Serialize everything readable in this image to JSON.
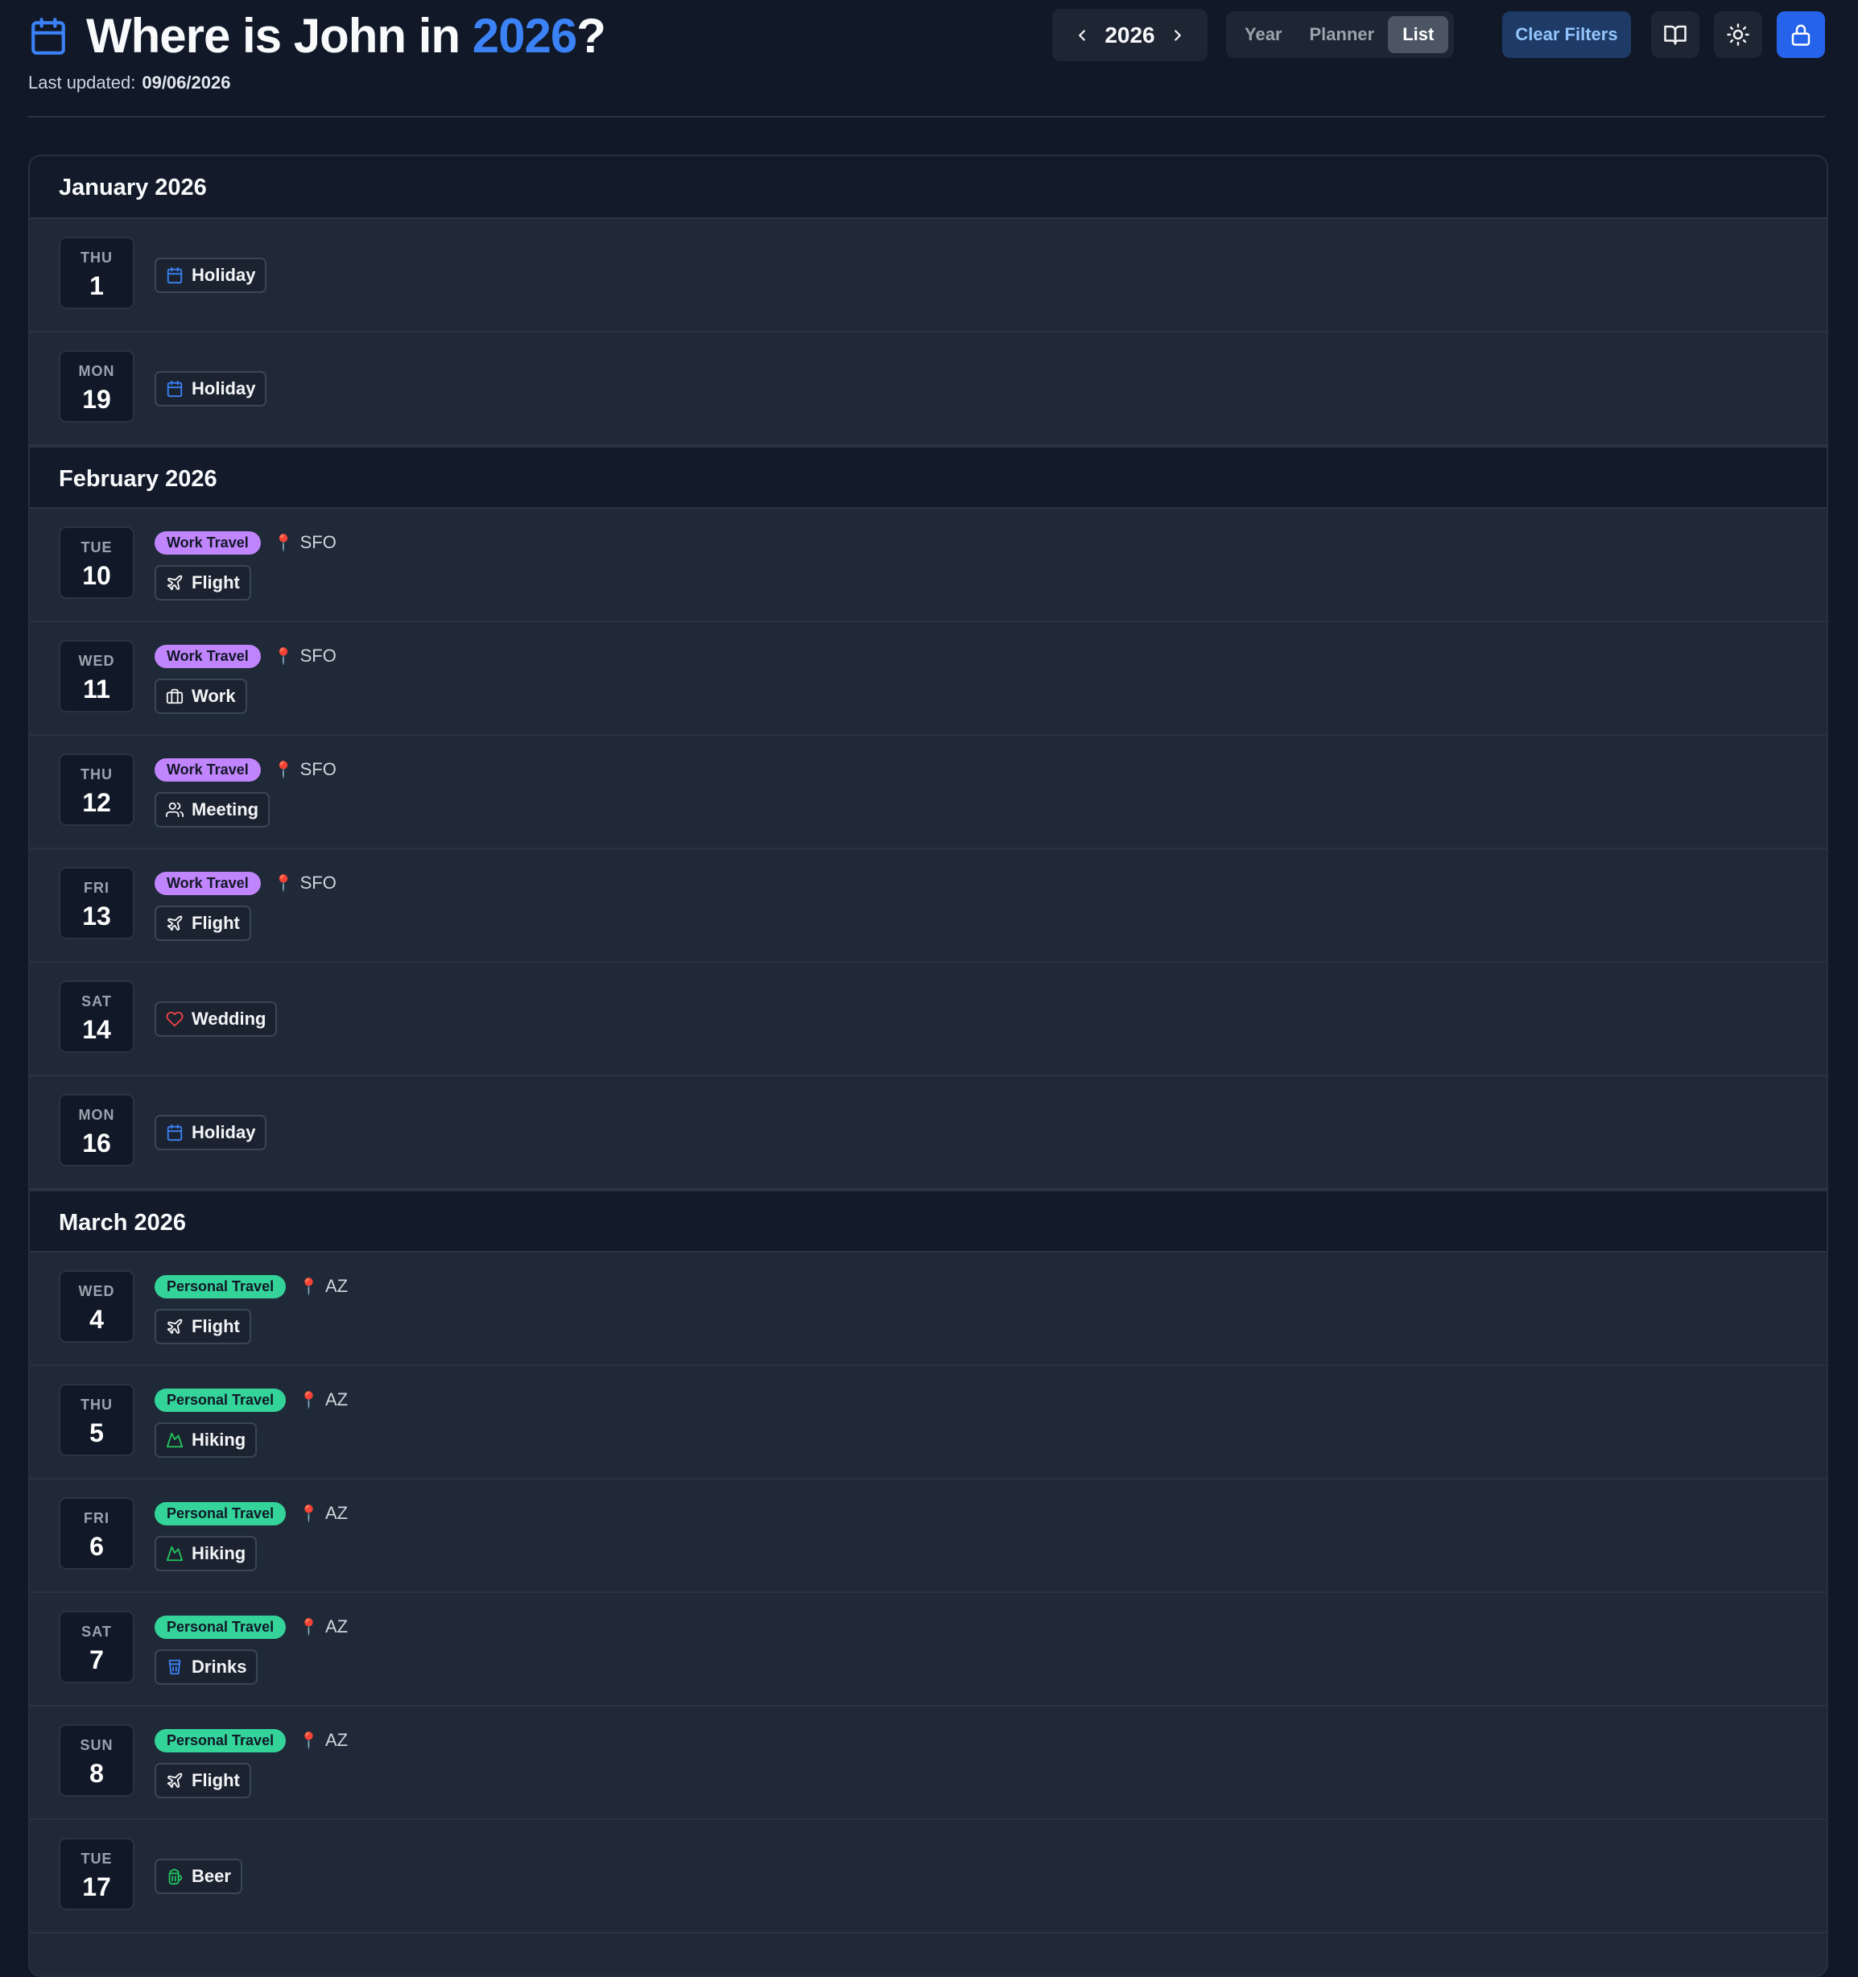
{
  "header": {
    "title_prefix": "Where is John in ",
    "title_year": "2026",
    "title_suffix": "?",
    "last_updated_label": "Last updated:",
    "last_updated_value": "09/06/2026",
    "year_nav_value": "2026",
    "view_tabs": [
      {
        "label": "Year",
        "active": false
      },
      {
        "label": "Planner",
        "active": false
      },
      {
        "label": "List",
        "active": true
      }
    ],
    "clear_filters_label": "Clear Filters",
    "icons": [
      "book-icon",
      "sun-icon",
      "lock-icon"
    ]
  },
  "colors": {
    "accent": "#3b82f6",
    "work_travel": "#c084fc",
    "personal_travel": "#34d399",
    "pin": "#ef4444",
    "background": "#111827"
  },
  "months": [
    {
      "label": "January 2026",
      "days": [
        {
          "dow": "THU",
          "day": "1",
          "activity": "Holiday",
          "icon": "calendar-icon"
        },
        {
          "dow": "MON",
          "day": "19",
          "activity": "Holiday",
          "icon": "calendar-icon"
        }
      ]
    },
    {
      "label": "February 2026",
      "days": [
        {
          "dow": "TUE",
          "day": "10",
          "category": "Work Travel",
          "location": "SFO",
          "activity": "Flight",
          "icon": "plane-icon"
        },
        {
          "dow": "WED",
          "day": "11",
          "category": "Work Travel",
          "location": "SFO",
          "activity": "Work",
          "icon": "briefcase-icon"
        },
        {
          "dow": "THU",
          "day": "12",
          "category": "Work Travel",
          "location": "SFO",
          "activity": "Meeting",
          "icon": "users-icon"
        },
        {
          "dow": "FRI",
          "day": "13",
          "category": "Work Travel",
          "location": "SFO",
          "activity": "Flight",
          "icon": "plane-icon"
        },
        {
          "dow": "SAT",
          "day": "14",
          "activity": "Wedding",
          "icon": "heart-icon"
        },
        {
          "dow": "MON",
          "day": "16",
          "activity": "Holiday",
          "icon": "calendar-icon"
        }
      ]
    },
    {
      "label": "March 2026",
      "days": [
        {
          "dow": "WED",
          "day": "4",
          "category": "Personal Travel",
          "location": "AZ",
          "activity": "Flight",
          "icon": "plane-icon"
        },
        {
          "dow": "THU",
          "day": "5",
          "category": "Personal Travel",
          "location": "AZ",
          "activity": "Hiking",
          "icon": "mountain-icon"
        },
        {
          "dow": "FRI",
          "day": "6",
          "category": "Personal Travel",
          "location": "AZ",
          "activity": "Hiking",
          "icon": "mountain-icon"
        },
        {
          "dow": "SAT",
          "day": "7",
          "category": "Personal Travel",
          "location": "AZ",
          "activity": "Drinks",
          "icon": "cup-icon"
        },
        {
          "dow": "SUN",
          "day": "8",
          "category": "Personal Travel",
          "location": "AZ",
          "activity": "Flight",
          "icon": "plane-icon"
        },
        {
          "dow": "TUE",
          "day": "17",
          "activity": "Beer",
          "icon": "beer-icon"
        }
      ]
    }
  ]
}
